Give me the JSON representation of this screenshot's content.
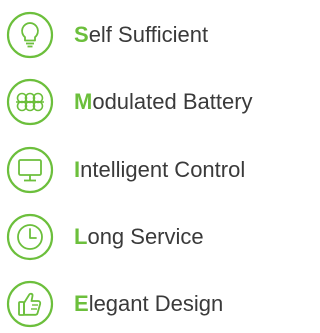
{
  "accent_color": "#6cbf3c",
  "text_color": "#3a3a3a",
  "features": [
    {
      "icon": "lightbulb-icon",
      "first_letter": "S",
      "rest": "elf Sufficient"
    },
    {
      "icon": "battery-module-icon",
      "first_letter": "M",
      "rest": "odulated Battery"
    },
    {
      "icon": "monitor-icon",
      "first_letter": "I",
      "rest": "ntelligent Control"
    },
    {
      "icon": "clock-icon",
      "first_letter": "L",
      "rest": "ong Service"
    },
    {
      "icon": "thumbs-up-icon",
      "first_letter": "E",
      "rest": "legant Design"
    }
  ]
}
